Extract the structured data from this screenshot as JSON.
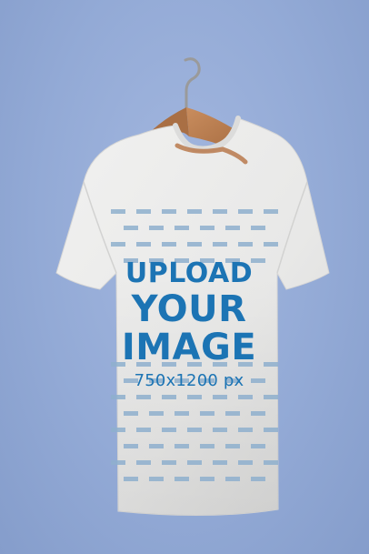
{
  "placeholder": {
    "line1": "UPLOAD",
    "line2": "YOUR",
    "line3": "IMAGE",
    "dimensions": "750x1200 px"
  },
  "colors": {
    "background": "#93aad6",
    "tshirt": "#ebebea",
    "hanger_wood": "#b8794c",
    "placeholder_text": "#1c74b4",
    "dash_marks": "#8fb0ce"
  },
  "icons": [
    "hanger-icon"
  ]
}
